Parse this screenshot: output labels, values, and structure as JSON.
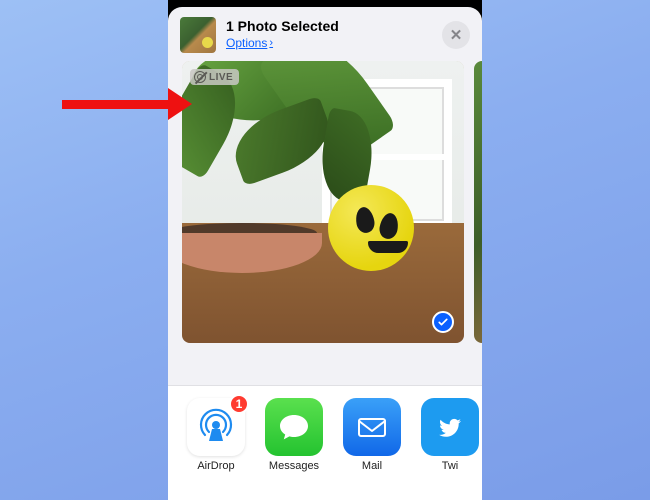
{
  "header": {
    "title": "1 Photo Selected",
    "options_label": "Options"
  },
  "live_badge": {
    "label": "LIVE"
  },
  "share_targets": [
    {
      "key": "airdrop",
      "label": "AirDrop",
      "badge": "1"
    },
    {
      "key": "messages",
      "label": "Messages",
      "badge": null
    },
    {
      "key": "mail",
      "label": "Mail",
      "badge": null
    },
    {
      "key": "twitter",
      "label": "Twi",
      "badge": null
    }
  ],
  "colors": {
    "accent": "#0a60ff",
    "badge_red": "#ff3b30"
  }
}
